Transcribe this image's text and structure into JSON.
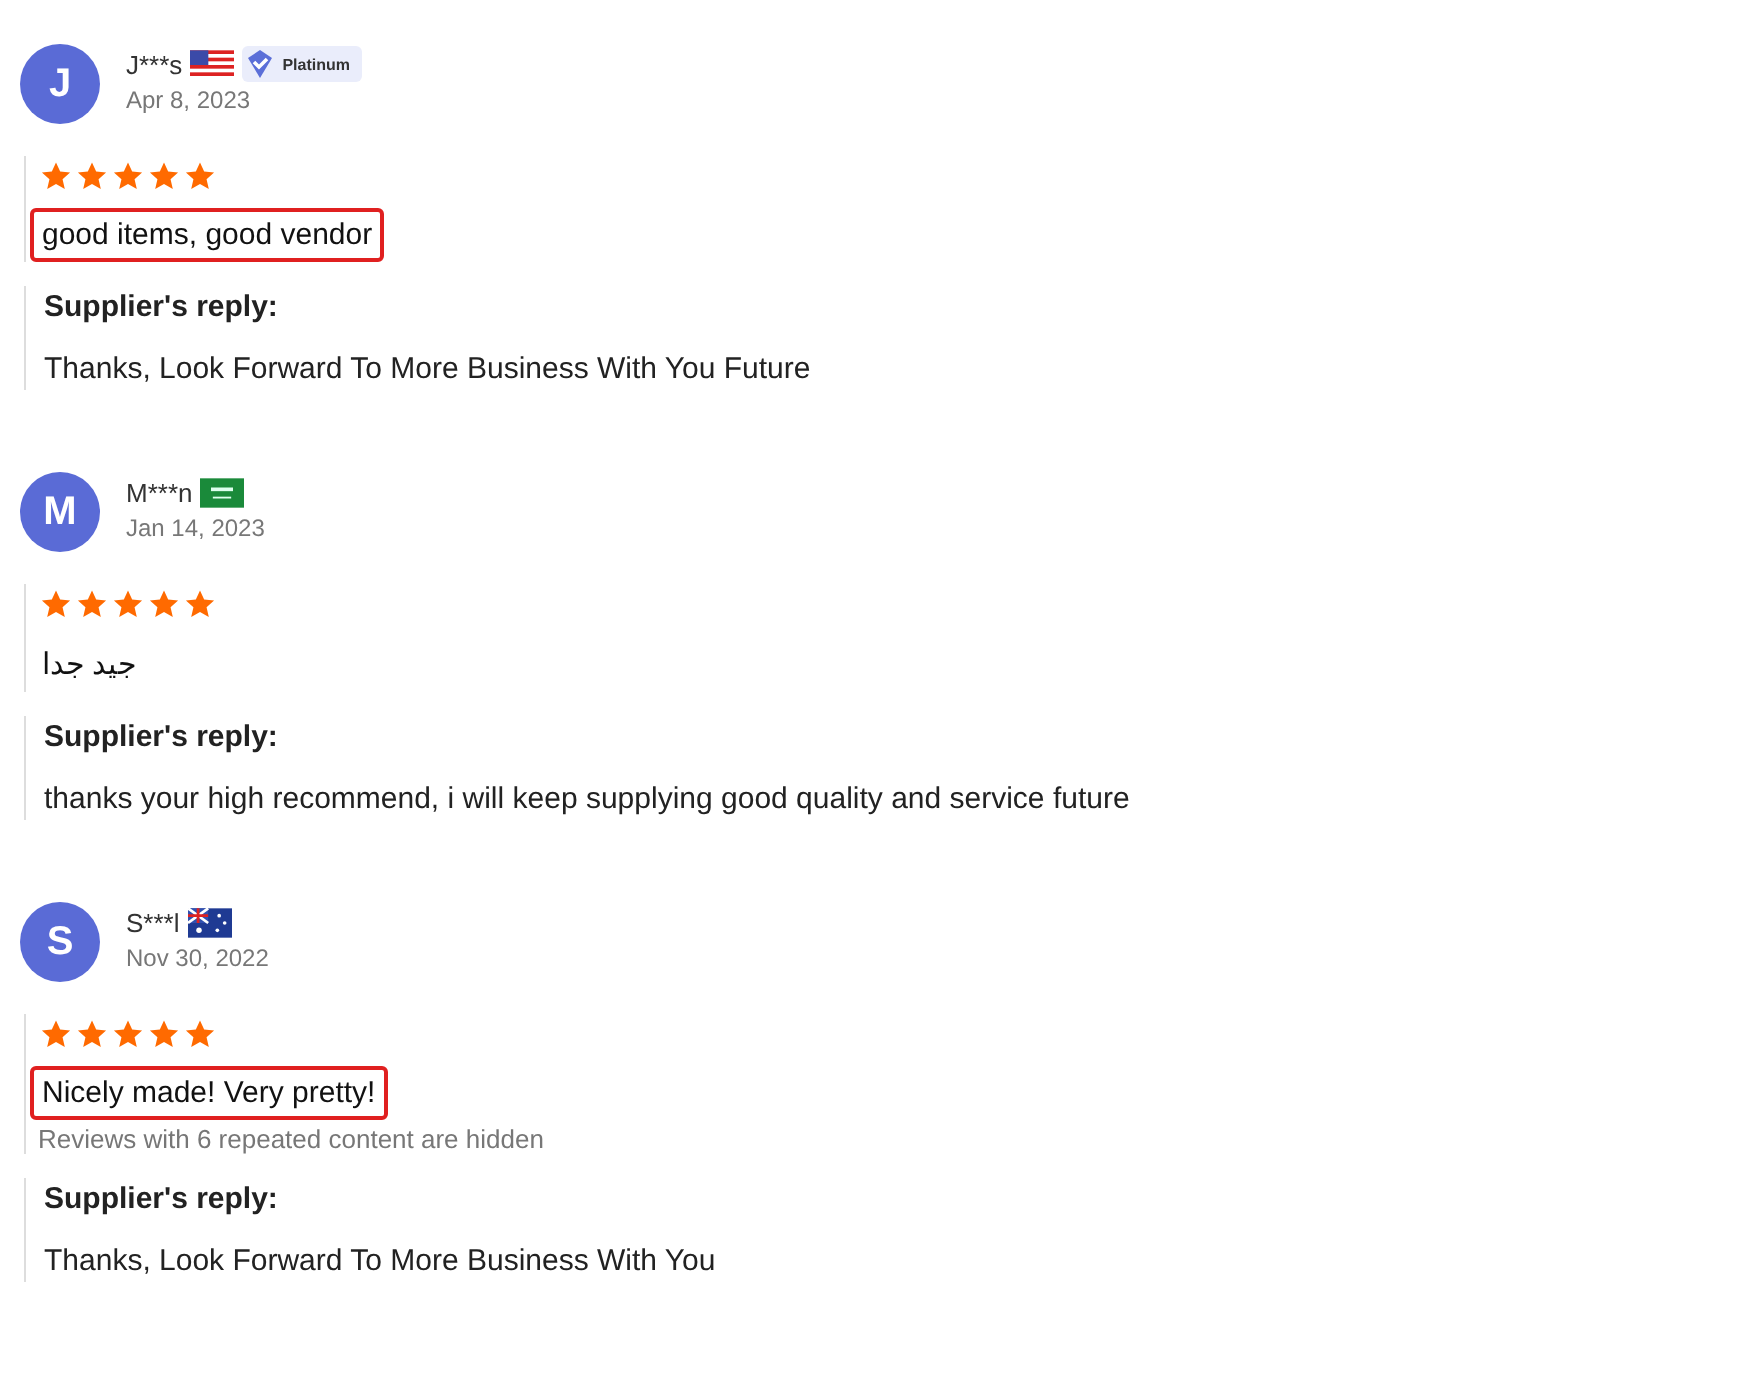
{
  "reviews": [
    {
      "avatar": "J",
      "name": "J***s",
      "flag": {
        "kind": "us"
      },
      "badge": "Platinum",
      "date": "Apr 8, 2023",
      "stars": 5,
      "comment": "good items, good vendor",
      "highlighted": true,
      "reply_label": "Supplier's reply:",
      "reply": "Thanks, Look Forward To More Business With You Future"
    },
    {
      "avatar": "M",
      "name": "M***n",
      "flag": {
        "kind": "sa"
      },
      "date": "Jan 14, 2023",
      "stars": 5,
      "comment": "جيد جدا",
      "highlighted": false,
      "reply_label": "Supplier's reply:",
      "reply": "thanks your high recommend, i will keep supplying good quality and service future"
    },
    {
      "avatar": "S",
      "name": "S***l",
      "flag": {
        "kind": "au"
      },
      "date": "Nov 30, 2022",
      "stars": 5,
      "comment": "Nicely made! Very pretty!",
      "highlighted": true,
      "note": "Reviews with 6 repeated content are hidden",
      "reply_label": "Supplier's reply:",
      "reply": "Thanks, Look Forward To More Business With You"
    }
  ]
}
